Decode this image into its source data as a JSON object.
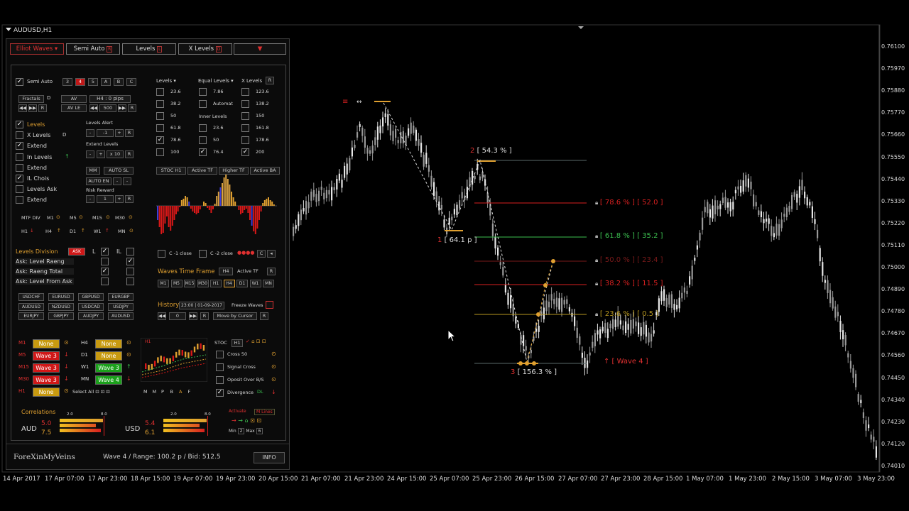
{
  "symbol": "AUDUSD,H1",
  "colors": {
    "bull": "#e6e6e6",
    "bear": "#999999",
    "red": "#d82020",
    "green": "#3cc050",
    "orange": "#e0a030",
    "gray": "#5a6a6a"
  },
  "y_axis": [
    "0.76100",
    "0.75970",
    "0.75880",
    "0.75770",
    "0.75660",
    "0.75550",
    "0.75440",
    "0.75330",
    "0.75220",
    "0.75110",
    "0.75000",
    "0.74890",
    "0.74780",
    "0.74670",
    "0.74560",
    "0.74450",
    "0.74340",
    "0.74230",
    "0.74120",
    "0.74010"
  ],
  "x_axis": [
    "14 Apr 2017",
    "17 Apr 07:00",
    "17 Apr 23:00",
    "18 Apr 15:00",
    "19 Apr 07:00",
    "19 Apr 23:00",
    "20 Apr 15:00",
    "21 Apr 07:00",
    "21 Apr 23:00",
    "24 Apr 15:00",
    "25 Apr 07:00",
    "25 Apr 23:00",
    "26 Apr 15:00",
    "27 Apr 07:00",
    "27 Apr 23:00",
    "28 Apr 15:00",
    "1 May 07:00",
    "1 May 23:00",
    "2 May 15:00",
    "3 May 07:00",
    "3 May 23:00"
  ],
  "wave_labels": {
    "w1": {
      "num": "1",
      "text": "[ 64.1 p ]"
    },
    "w2": {
      "num": "2",
      "text": "[ 54.3 % ]"
    },
    "w3": {
      "num": "3",
      "text": "[ 156.3 % ]"
    },
    "w4": "↑ [ Wave 4 ]"
  },
  "fib_levels": [
    {
      "text": "[ 78.6 % ]  [ 52.0 ]",
      "color": "#d82020"
    },
    {
      "text": "[ 61.8 % ]  [ 35.2 ]",
      "color": "#3cc050"
    },
    {
      "text": "[ 50.0 % ]  [ 23.4 ]",
      "color": "#7a1a1a"
    },
    {
      "text": "[ 38.2 % ]  [ 11.5 ]",
      "color": "#d82020"
    },
    {
      "text": "[ 23.6 % ]  [ 0.5 ]",
      "color": "#b89820"
    }
  ],
  "panel": {
    "tabs": [
      "Elliot Waves",
      "Semi Auto",
      "Levels",
      "X Levels"
    ],
    "tab_flags": [
      "R",
      "L",
      "D"
    ],
    "semi_auto": "Semi Auto",
    "wave_nums": [
      "3",
      "4",
      "5",
      "A",
      "B",
      "C"
    ],
    "fractals": "Fractals",
    "d": "D",
    "av": "AV",
    "av_le": "AV LE",
    "h4_pips": "H4 : 0  pips",
    "val_500": "500",
    "r": "R",
    "left_opts": [
      "Levels",
      "X Levels",
      "Extend",
      "In Levels",
      "Extend",
      "IL Chois",
      "Levels Ask",
      "Extend"
    ],
    "levels_alert": "Levels Alert",
    "alert_val": "-1",
    "extend_levels": "Extend Levels",
    "x10": "x 10",
    "mm": "MM",
    "auto_sl": "AUTO SL",
    "auto_en": "AUTO EN",
    "risk_reward": "Risk Reward",
    "rr_val": "1",
    "mtf_div": "MTF DIV",
    "tfs_row1": [
      "M1",
      "M5",
      "M15",
      "M30"
    ],
    "tfs_row2": [
      "H1",
      "H4",
      "D1",
      "W1",
      "MN"
    ],
    "col_levels": "Levels",
    "col_equal": "Equal Levels",
    "col_x": "X Levels",
    "levels_vals": [
      "23.6",
      "38.2",
      "50",
      "61.8",
      "78.6",
      "100"
    ],
    "equal_vals": [
      "7.86",
      "Automat",
      "",
      "23.6",
      "50",
      "76.4"
    ],
    "inner_levels": "Inner Levels",
    "x_vals": [
      "123.6",
      "138.2",
      "150",
      "161.8",
      "178.6",
      "200"
    ],
    "ind_tabs": [
      "STOC H1",
      "Active TF",
      "Higher TF",
      "Active BA"
    ],
    "c1_close": "C -1 close",
    "c2_close": "C -2 close",
    "c_label": "C",
    "levels_division": "Levels Division",
    "ask_badge": "ASK",
    "l": "L",
    "il": "IL",
    "ask_rows": [
      "Ask: Level Raeng",
      "Ask: Raeng Total",
      "Ask: Level From Ask"
    ],
    "waves_tf": "Waves Time Frame",
    "waves_tf_val": "H4",
    "active_tf": "Active TF",
    "wave_tf_buttons": [
      "M1",
      "M5",
      "M15",
      "M30",
      "H1",
      "H4",
      "D1",
      "W1",
      "MN"
    ],
    "pairs": [
      "USDCHF",
      "EURUSD",
      "GBPUSD",
      "EURGBP",
      "AUDUSD",
      "NZDUSD",
      "USDCAD",
      "USDJPY",
      "EURJPY",
      "GBPJPY",
      "AUDJPY",
      "AUDUSD"
    ],
    "history": "History",
    "history_date": "23:00 | 01-09-2017",
    "freeze_waves": "Freeze Waves",
    "hist_val": "0",
    "move_by_cursor": "Move by Cursor",
    "wave_status": [
      {
        "tf": "M1",
        "val": "None",
        "kind": "yel",
        "tf2": "H4",
        "val2": "None",
        "kind2": "yel"
      },
      {
        "tf": "M5",
        "val": "Wave 3",
        "kind": "redb",
        "tf2": "D1",
        "val2": "None",
        "kind2": "yel"
      },
      {
        "tf": "M15",
        "val": "Wave 3",
        "kind": "redb",
        "tf2": "W1",
        "val2": "Wave 3",
        "kind2": "grnb"
      },
      {
        "tf": "M30",
        "val": "Wave 3",
        "kind": "redb",
        "tf2": "MN",
        "val2": "Wave 4",
        "kind2": "grnb"
      },
      {
        "tf": "H1",
        "val": "None",
        "kind": "yel"
      }
    ],
    "select_all": "Select All",
    "mini_h1": "H1",
    "mini_letters": [
      "M",
      "M",
      "P",
      "B",
      "A",
      "F"
    ],
    "stoc": "STOC",
    "stoc_h1": "H1",
    "stoc_opts": [
      "Cross 50",
      "Signal Cross",
      "Oposit Over B/S",
      "Divergence"
    ],
    "dl": "DL",
    "correlations": "Correlations",
    "corr_scale": [
      "2.0",
      "8.0"
    ],
    "aud": "AUD",
    "aud_vals": [
      "5.0",
      "7.5"
    ],
    "usd": "USD",
    "usd_vals": [
      "5.4",
      "6.1"
    ],
    "activate": "Activate",
    "m_lines": "M Lines",
    "min": "Min",
    "min_val": "2",
    "max": "Max",
    "max_val": "6",
    "brand": "ForeXinMyVeins",
    "status": "Wave 4  /  Range: 100.2 p  /  Bid: 512.5",
    "info": "INFO"
  }
}
